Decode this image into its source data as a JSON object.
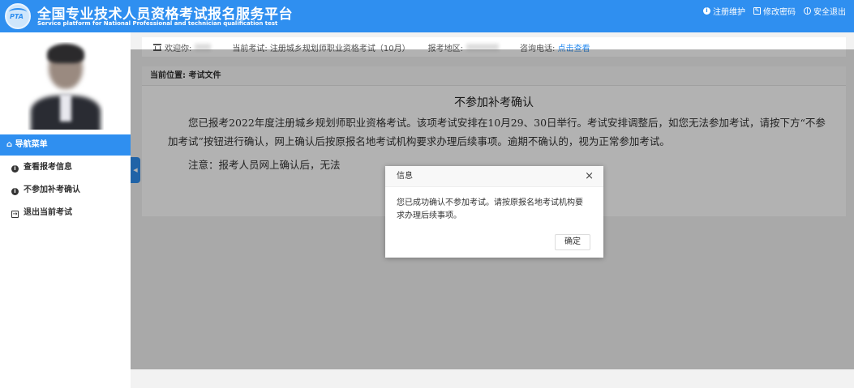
{
  "header": {
    "title_cn": "全国专业技术人员资格考试报名服务平台",
    "title_en": "Service platform for National Professional and technician qualification test",
    "logo_text": "PTA",
    "links": [
      {
        "label": "注册维护",
        "icon": "info-icon"
      },
      {
        "label": "修改密码",
        "icon": "edit-icon"
      },
      {
        "label": "安全退出",
        "icon": "power-icon"
      }
    ]
  },
  "infobar": {
    "welcome": "欢迎你:",
    "exam": "当前考试: 注册城乡规划师职业资格考试（10月）",
    "region": "报考地区:",
    "phone": "咨询电话:",
    "phone_link": "点击查看"
  },
  "sidebar": {
    "nav_header": "导航菜单",
    "items": [
      {
        "label": "查看报考信息",
        "icon": "info-icon"
      },
      {
        "label": "不参加补考确认",
        "icon": "info-icon"
      },
      {
        "label": "退出当前考试",
        "icon": "exit-icon"
      }
    ]
  },
  "content": {
    "breadcrumb": "当前位置: 考试文件",
    "title": "不参加补考确认",
    "para1": "您已报考2022年度注册城乡规划师职业资格考试。该项考试安排在10月29、30日举行。考试安排调整后，如您无法参加考试，请按下方“不参加考试”按钮进行确认，网上确认后按原报名地考试机构要求办理后续事项。逾期不确认的，视为正常参加考试。",
    "para2": "注意：报考人员网上确认后，无法"
  },
  "dialog": {
    "title": "信息",
    "close": "×",
    "message": "您已成功确认不参加考试。请按原报名地考试机构要求办理后续事项。",
    "confirm": "确定"
  }
}
